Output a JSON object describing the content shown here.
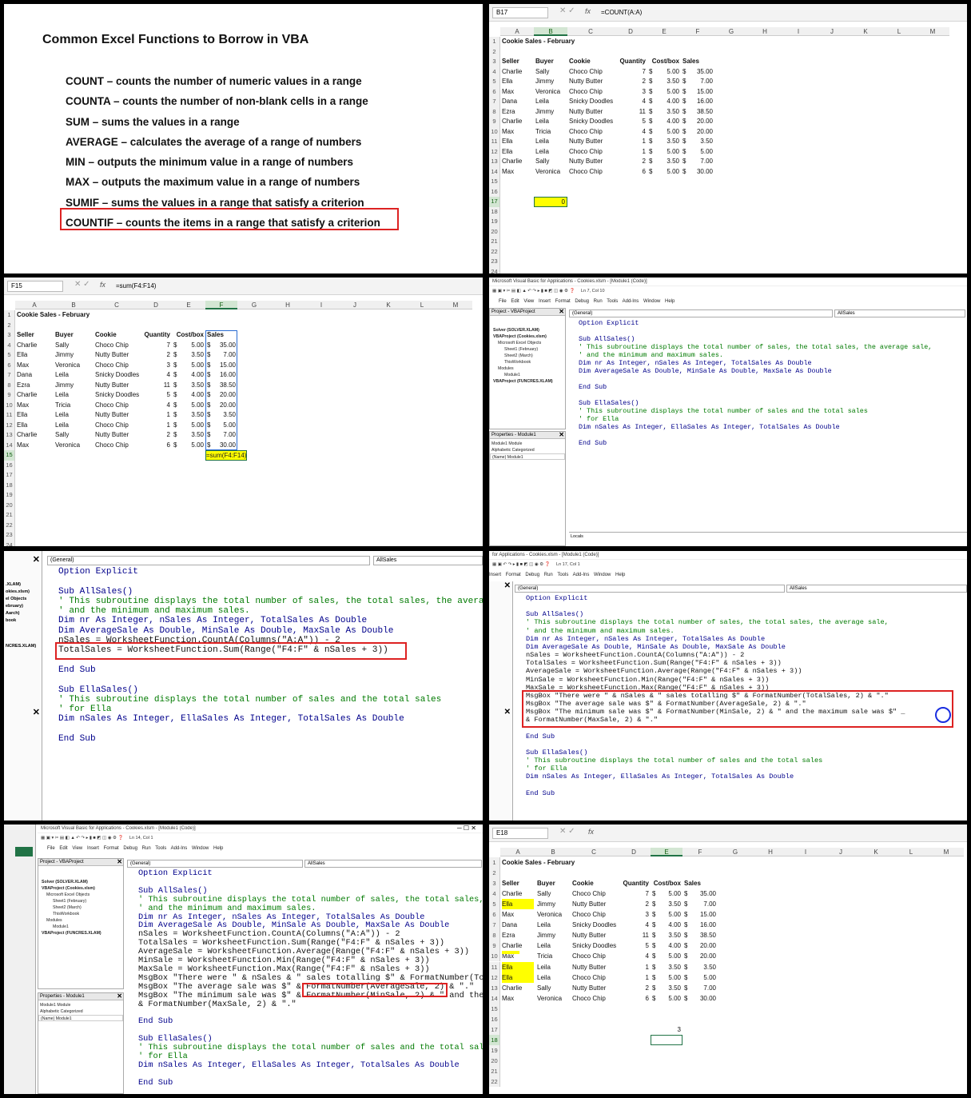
{
  "slide": {
    "title": "Common Excel Functions to Borrow in VBA",
    "items": [
      "COUNT – counts the number of numeric values in a range",
      "COUNTA – counts the number of non-blank cells in a range",
      "SUM – sums the values in a range",
      "AVERAGE – calculates the average of a range of numbers",
      "MIN – outputs the minimum value in a range of numbers",
      "MAX – outputs the maximum value in a range of numbers",
      "SUMIF – sums the values in a range that satisfy a criterion",
      "COUNTIF – counts the items in a range that satisfy a criterion"
    ]
  },
  "sheet": {
    "title": "Cookie Sales - February",
    "headers": [
      "Seller",
      "Buyer",
      "Cookie",
      "Quantity",
      "Cost/box",
      "Sales"
    ],
    "rows": [
      [
        "Charlie",
        "Sally",
        "Choco Chip",
        "7",
        "$",
        "5.00",
        "$",
        "35.00"
      ],
      [
        "Ella",
        "Jimmy",
        "Nutty Butter",
        "2",
        "$",
        "3.50",
        "$",
        "7.00"
      ],
      [
        "Max",
        "Veronica",
        "Choco Chip",
        "3",
        "$",
        "5.00",
        "$",
        "15.00"
      ],
      [
        "Dana",
        "Leila",
        "Snicky Doodles",
        "4",
        "$",
        "4.00",
        "$",
        "16.00"
      ],
      [
        "Ezra",
        "Jimmy",
        "Nutty Butter",
        "11",
        "$",
        "3.50",
        "$",
        "38.50"
      ],
      [
        "Charlie",
        "Leila",
        "Snicky Doodles",
        "5",
        "$",
        "4.00",
        "$",
        "20.00"
      ],
      [
        "Max",
        "Tricia",
        "Choco Chip",
        "4",
        "$",
        "5.00",
        "$",
        "20.00"
      ],
      [
        "Ella",
        "Leila",
        "Nutty Butter",
        "1",
        "$",
        "3.50",
        "$",
        "3.50"
      ],
      [
        "Ella",
        "Leila",
        "Choco Chip",
        "1",
        "$",
        "5.00",
        "$",
        "5.00"
      ],
      [
        "Charlie",
        "Sally",
        "Nutty Butter",
        "2",
        "$",
        "3.50",
        "$",
        "7.00"
      ],
      [
        "Max",
        "Veronica",
        "Choco Chip",
        "6",
        "$",
        "5.00",
        "$",
        "30.00"
      ]
    ],
    "columns": [
      "A",
      "B",
      "C",
      "D",
      "E",
      "F",
      "G",
      "H",
      "I",
      "J",
      "K",
      "L",
      "M"
    ]
  },
  "excel_a": {
    "cell": "B17",
    "formula": "=COUNT(A:A)",
    "result": "0"
  },
  "excel_b": {
    "cell": "F15",
    "formula": "=sum(F4:F14)",
    "cell_text": "=sum(F4:F14)"
  },
  "excel_c": {
    "cell": "E18",
    "formula": "",
    "result": "3"
  },
  "vbe": {
    "title_full": "Microsoft Visual Basic for Applications - Cookies.xlsm - [Module1 (Code)]",
    "title_partial": "for Applications - Cookies.xlsm - [Module1 (Code)]",
    "menu": [
      "File",
      "Edit",
      "View",
      "Insert",
      "Format",
      "Debug",
      "Run",
      "Tools",
      "Add-Ins",
      "Window",
      "Help"
    ],
    "pos_a": "Ln 7, Col 10",
    "pos_b": "Ln 17, Col 1",
    "pos_c": "Ln 14, Col 1",
    "combo_left": "(General)",
    "combo_right": "AllSales",
    "project_title": "Project - VBAProject",
    "tree": [
      "Solver (SOLVER.XLAM)",
      "VBAProject (Cookies.xlsm)",
      "Microsoft Excel Objects",
      "Sheet1 (February)",
      "Sheet2 (March)",
      "ThisWorkbook",
      "Modules",
      "Module1",
      "VBAProject (FUNCRES.XLAM)"
    ],
    "properties_title": "Properties - Module1",
    "properties_object": "Module1 Module",
    "properties_tabs": "Alphabetic   Categorized",
    "properties_row": "(Name)   Module1",
    "locals": "Locals"
  },
  "code1": [
    "Option Explicit",
    "",
    "Sub AllSales()",
    "' This subroutine displays the total number of sales, the total sales, the average sale,",
    "' and the minimum and maximum sales.",
    "Dim nr As Integer, nSales As Integer, TotalSales As Double",
    "Dim AverageSale As Double, MinSale As Double, MaxSale As Double",
    "",
    "End Sub",
    "",
    "Sub EllaSales()",
    "' This subroutine displays the total number of sales and the total sales",
    "' for Ella",
    "Dim nSales As Integer, EllaSales As Integer, TotalSales As Double",
    "",
    "End Sub"
  ],
  "code2": [
    "Option Explicit",
    "",
    "Sub AllSales()",
    "' This subroutine displays the total number of sales, the total sales, the average sale,",
    "' and the minimum and maximum sales.",
    "Dim nr As Integer, nSales As Integer, TotalSales As Double",
    "Dim AverageSale As Double, MinSale As Double, MaxSale As Double",
    "nSales = WorksheetFunction.CountA(Columns(\"A:A\")) - 2",
    "TotalSales = WorksheetFunction.Sum(Range(\"F4:F\" & nSales + 3))",
    "",
    "End Sub",
    "",
    "Sub EllaSales()",
    "' This subroutine displays the total number of sales and the total sales",
    "' for Ella",
    "Dim nSales As Integer, EllaSales As Integer, TotalSales As Double",
    "",
    "End Sub"
  ],
  "code3": [
    "Option Explicit",
    "",
    "Sub AllSales()",
    "' This subroutine displays the total number of sales, the total sales, the average sale,",
    "' and the minimum and maximum sales.",
    "Dim nr As Integer, nSales As Integer, TotalSales As Double",
    "Dim AverageSale As Double, MinSale As Double, MaxSale As Double",
    "nSales = WorksheetFunction.CountA(Columns(\"A:A\")) - 2",
    "TotalSales = WorksheetFunction.Sum(Range(\"F4:F\" & nSales + 3))",
    "AverageSale = WorksheetFunction.Average(Range(\"F4:F\" & nSales + 3))",
    "MinSale = WorksheetFunction.Min(Range(\"F4:F\" & nSales + 3))",
    "MaxSale = WorksheetFunction.Max(Range(\"F4:F\" & nSales + 3))",
    "MsgBox \"There were \" & nSales & \" sales totalling $\" & FormatNumber(TotalSales, 2) & \".\"",
    "MsgBox \"The average sale was $\" & FormatNumber(AverageSale, 2) & \".\"",
    "MsgBox \"The minimum sale was $\" & FormatNumber(MinSale, 2) & \" and the maximum sale was $\" _",
    "& FormatNumber(MaxSale, 2) & \".\"",
    "",
    "End Sub",
    "",
    "Sub EllaSales()",
    "' This subroutine displays the total number of sales and the total sales",
    "' for Ella",
    "Dim nSales As Integer, EllaSales As Integer, TotalSales As Double",
    "",
    "End Sub"
  ]
}
